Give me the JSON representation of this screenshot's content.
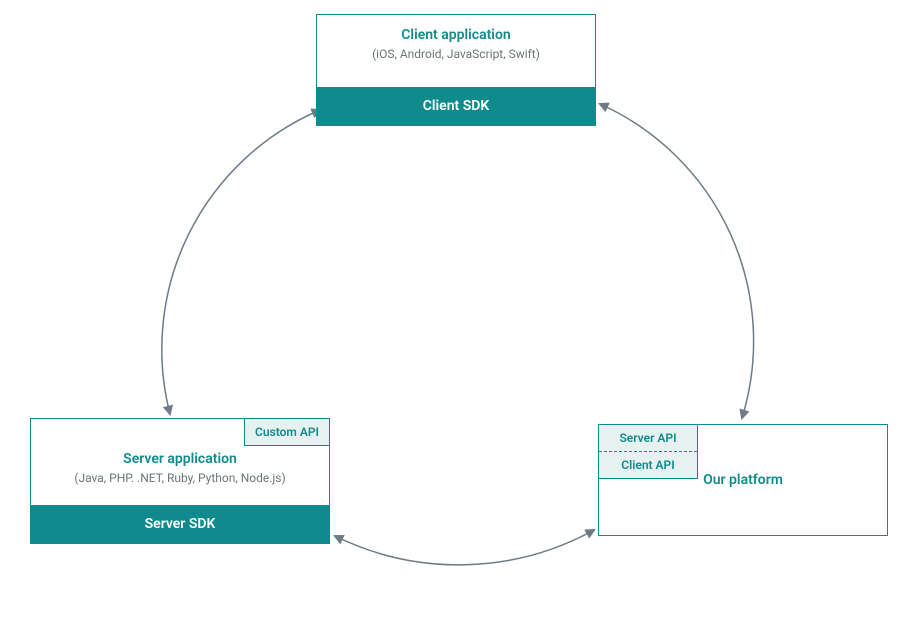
{
  "client": {
    "title": "Client application",
    "sub": "(iOS, Android, JavaScript, Swift)",
    "sdk": "Client SDK"
  },
  "server": {
    "tag": "Custom API",
    "title": "Server application",
    "sub": "(Java, PHP. .NET, Ruby, Python, Node.js)",
    "sdk": "Server SDK"
  },
  "platform": {
    "api1": "Server API",
    "api2": "Client API",
    "title": "Our platform"
  },
  "colors": {
    "teal": "#0f8b8d",
    "tealLight": "#e6f1f1",
    "arrow": "#6e7a86",
    "muted": "#6b7577"
  }
}
